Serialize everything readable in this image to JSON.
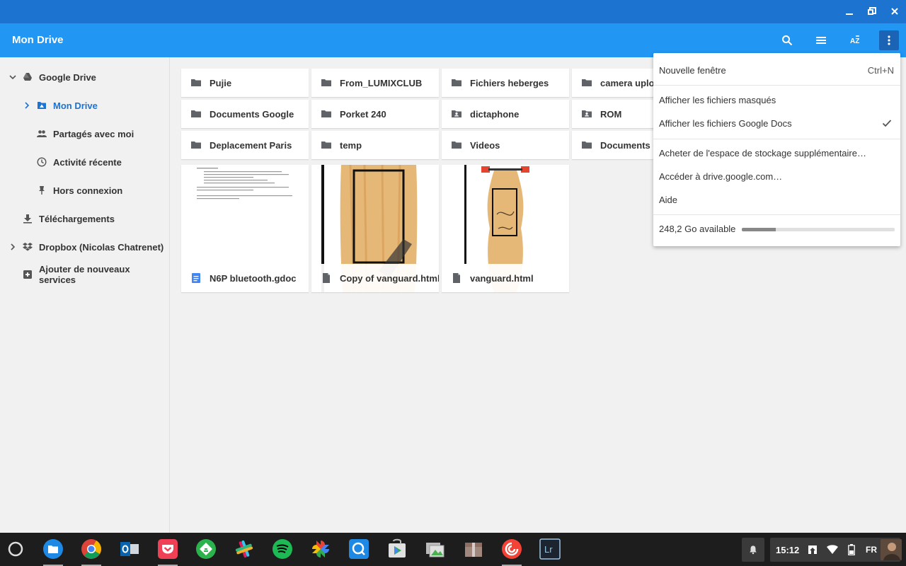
{
  "window": {
    "minimize_icon": "minimize-icon",
    "maximize_icon": "restore-icon",
    "close_icon": "close-icon"
  },
  "header": {
    "title": "Mon Drive",
    "toolbar": [
      "search-icon",
      "list-view-icon",
      "sort-az-icon",
      "more-vert-icon"
    ]
  },
  "sidebar": {
    "items": [
      {
        "label": "Google Drive",
        "icon": "google-drive-icon"
      },
      {
        "label": "Mon Drive",
        "icon": "my-drive-icon"
      },
      {
        "label": "Partagés avec moi",
        "icon": "people-icon"
      },
      {
        "label": "Activité récente",
        "icon": "clock-icon"
      },
      {
        "label": "Hors connexion",
        "icon": "pin-icon"
      },
      {
        "label": "Téléchargements",
        "icon": "download-icon"
      },
      {
        "label": "Dropbox (Nicolas Chatrenet)",
        "icon": "dropbox-icon"
      },
      {
        "label": "Ajouter de nouveaux services",
        "icon": "add-box-icon"
      }
    ]
  },
  "folders": [
    {
      "name": "Pujie",
      "icon": "folder-icon"
    },
    {
      "name": "From_LUMIXCLUB",
      "icon": "folder-icon"
    },
    {
      "name": "Fichiers heberges",
      "icon": "folder-icon"
    },
    {
      "name": "camera uploads",
      "icon": "folder-icon"
    },
    {
      "name": "Documents Google",
      "icon": "folder-icon"
    },
    {
      "name": "Porket 240",
      "icon": "folder-icon"
    },
    {
      "name": "dictaphone",
      "icon": "shared-folder-icon"
    },
    {
      "name": "ROM",
      "icon": "shared-folder-icon"
    },
    {
      "name": "Deplacement Paris",
      "icon": "folder-icon"
    },
    {
      "name": "temp",
      "icon": "folder-icon"
    },
    {
      "name": "Videos",
      "icon": "folder-icon"
    },
    {
      "name": "Documents d",
      "icon": "folder-icon"
    }
  ],
  "files": [
    {
      "name": "N6P bluetooth.gdoc",
      "icon": "google-doc-icon"
    },
    {
      "name": "Copy of vanguard.html",
      "icon": "file-icon"
    },
    {
      "name": "vanguard.html",
      "icon": "file-icon"
    }
  ],
  "menu": {
    "new_window": "Nouvelle fenêtre",
    "new_window_shortcut": "Ctrl+N",
    "show_hidden": "Afficher les fichiers masqués",
    "show_gdocs": "Afficher les fichiers Google Docs",
    "buy_storage": "Acheter de l'espace de stockage supplémentaire…",
    "go_drive": "Accéder à drive.google.com…",
    "help": "Aide",
    "storage_text": "248,2 Go available",
    "storage_used_fraction": 0.22,
    "check_icon": "check-icon"
  },
  "shelf": {
    "apps": [
      "launcher-icon",
      "files-app-icon",
      "chrome-icon",
      "outlook-icon",
      "pocket-icon",
      "feedly-icon",
      "slack-icon",
      "spotify-icon",
      "google-photos-icon",
      "quicktime-icon",
      "play-store-icon",
      "photo-viewer-icon",
      "archive-icon",
      "pocket-casts-icon",
      "lightroom-icon"
    ],
    "time": "15:12",
    "lang": "FR"
  },
  "colors": {
    "titlebar": "#1c73d0",
    "appbar": "#2196f3",
    "accent": "#1c73d0"
  }
}
